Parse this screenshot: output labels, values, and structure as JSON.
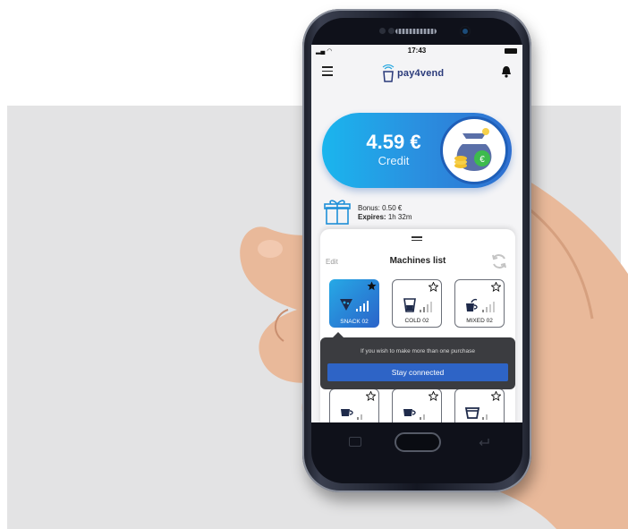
{
  "status_bar": {
    "time": "17:43"
  },
  "header": {
    "logo_text": "pay4vend"
  },
  "credit": {
    "amount": "4.59 €",
    "label": "Credit"
  },
  "bonus": {
    "bonus_text": "Bonus: 0.50 €",
    "expires_label": "Expires:",
    "expires_value": "1h 32m"
  },
  "machines": {
    "edit_label": "Edit",
    "title": "Machines list",
    "items": [
      {
        "label": "SNACK 02",
        "icon": "snack-icon",
        "favorite": true,
        "selected": true
      },
      {
        "label": "COLD 02",
        "icon": "cold-drink-icon",
        "favorite": false,
        "selected": false
      },
      {
        "label": "MIXED 02",
        "icon": "mixed-icon",
        "favorite": false,
        "selected": false
      },
      {
        "label": "",
        "icon": "coffee-icon",
        "favorite": false,
        "selected": false
      },
      {
        "label": "",
        "icon": "coffee-icon",
        "favorite": false,
        "selected": false
      },
      {
        "label": "",
        "icon": "cup-icon",
        "favorite": false,
        "selected": false
      }
    ]
  },
  "tooltip": {
    "message": "If you wish to make more than one purchase",
    "button_label": "Stay connected"
  },
  "colors": {
    "accent_blue": "#2e64c6",
    "gradient_start": "#1ab6ee",
    "tooltip_bg": "#3b3c40"
  }
}
